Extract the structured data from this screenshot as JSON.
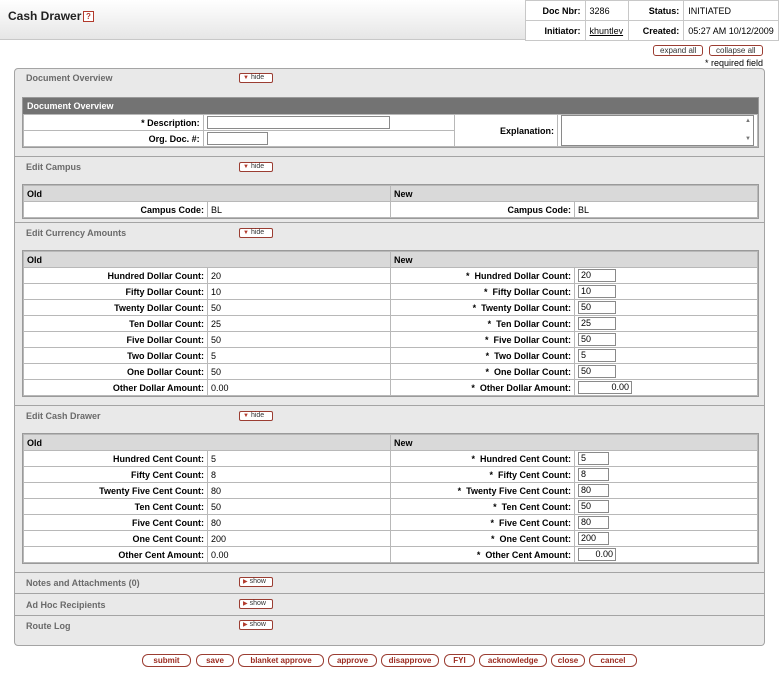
{
  "header": {
    "title": "Cash Drawer",
    "help": "?",
    "doc_nbr_label": "Doc Nbr:",
    "doc_nbr": "3286",
    "status_label": "Status:",
    "status": "INITIATED",
    "initiator_label": "Initiator:",
    "initiator": "khuntlev",
    "created_label": "Created:",
    "created": "05:27 AM 10/12/2009"
  },
  "controls": {
    "expand_all": "expand all",
    "collapse_all": "collapse all",
    "required_note": "* required field"
  },
  "tabs": {
    "overview": {
      "label": "Document Overview",
      "toggle": "hide"
    },
    "campus": {
      "label": "Edit Campus",
      "toggle": "hide"
    },
    "currency": {
      "label": "Edit Currency Amounts",
      "toggle": "hide"
    },
    "cash": {
      "label": "Edit Cash Drawer",
      "toggle": "hide"
    },
    "notes": {
      "label": "Notes and Attachments (0)",
      "toggle": "show"
    },
    "adhoc": {
      "label": "Ad Hoc Recipients",
      "toggle": "show"
    },
    "route": {
      "label": "Route Log",
      "toggle": "show"
    }
  },
  "overview": {
    "section_title": "Document Overview",
    "description_label": "* Description:",
    "description_value": "",
    "org_doc_label": "Org. Doc. #:",
    "org_doc_value": "",
    "explanation_label": "Explanation:",
    "explanation_value": ""
  },
  "campus": {
    "old_header": "Old",
    "new_header": "New",
    "label": "Campus Code:",
    "old_value": "BL",
    "new_value": "BL"
  },
  "currency": {
    "old_header": "Old",
    "new_header": "New",
    "rows": [
      {
        "label": "Hundred Dollar Count:",
        "old": "20",
        "new": "20"
      },
      {
        "label": "Fifty Dollar Count:",
        "old": "10",
        "new": "10"
      },
      {
        "label": "Twenty Dollar Count:",
        "old": "50",
        "new": "50"
      },
      {
        "label": "Ten Dollar Count:",
        "old": "25",
        "new": "25"
      },
      {
        "label": "Five Dollar Count:",
        "old": "50",
        "new": "50"
      },
      {
        "label": "Two Dollar Count:",
        "old": "5",
        "new": "5"
      },
      {
        "label": "One Dollar Count:",
        "old": "50",
        "new": "50"
      },
      {
        "label": "Other Dollar Amount:",
        "old": "0.00",
        "new": "0.00"
      }
    ]
  },
  "cash": {
    "old_header": "Old",
    "new_header": "New",
    "rows": [
      {
        "label": "Hundred Cent Count:",
        "old": "5",
        "new": "5"
      },
      {
        "label": "Fifty Cent Count:",
        "old": "8",
        "new": "8"
      },
      {
        "label": "Twenty Five Cent Count:",
        "old": "80",
        "new": "80"
      },
      {
        "label": "Ten Cent Count:",
        "old": "50",
        "new": "50"
      },
      {
        "label": "Five Cent Count:",
        "old": "80",
        "new": "80"
      },
      {
        "label": "One Cent Count:",
        "old": "200",
        "new": "200"
      },
      {
        "label": "Other Cent Amount:",
        "old": "0.00",
        "new": "0.00"
      }
    ]
  },
  "buttons": {
    "submit": "submit",
    "save": "save",
    "blanket_approve": "blanket approve",
    "approve": "approve",
    "disapprove": "disapprove",
    "fyi": "FYI",
    "acknowledge": "acknowledge",
    "close": "close",
    "cancel": "cancel"
  },
  "colors": {
    "button_border": "#9b3d32",
    "section_header": "#737373"
  }
}
